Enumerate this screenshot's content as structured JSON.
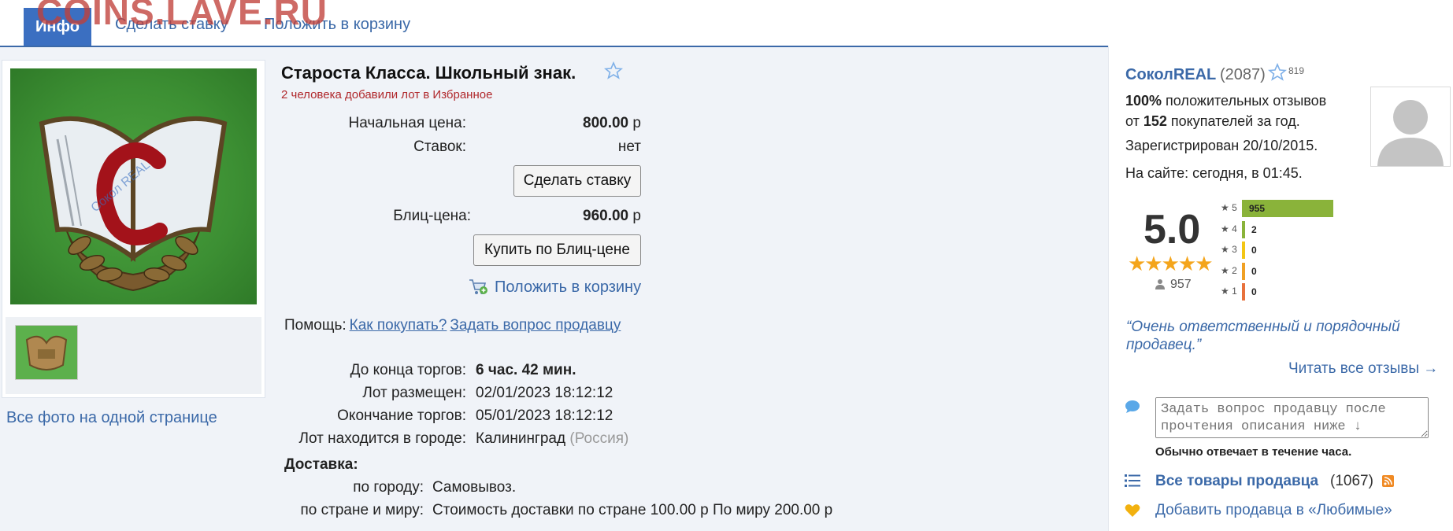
{
  "watermark": "COINS.LAVE.RU",
  "tabs": {
    "info": "Инфо",
    "bid": "Сделать ставку",
    "cart": "Положить в корзину"
  },
  "gallery": {
    "all_photos": "Все фото на одной странице",
    "photo_caption": "Сокол REAL",
    "photo_letter": "С"
  },
  "lot": {
    "title": "Староста Класса. Школьный знак.",
    "favorites_note": "2 человека добавили лот в Избранное",
    "start_price_label": "Начальная цена:",
    "start_price_value": "800.00",
    "currency": "р",
    "bids_label": "Ставок:",
    "bids_value": "нет",
    "bid_button": "Сделать ставку",
    "blitz_label": "Блиц-цена:",
    "blitz_value": "960.00",
    "blitz_button": "Купить по Блиц-цене",
    "cart_link": "Положить в корзину",
    "help_label": "Помощь:",
    "help_how": "Как покупать?",
    "help_ask": "Задать вопрос продавцу",
    "time_left_label": "До конца торгов:",
    "time_left_value": "6 час. 42 мин.",
    "placed_label": "Лот размещен:",
    "placed_value": "02/01/2023 18:12:12",
    "ends_label": "Окончание торгов:",
    "ends_value": "05/01/2023 18:12:12",
    "city_label": "Лот находится в городе:",
    "city_value": "Калининград",
    "country_value": "(Россия)",
    "delivery_heading": "Доставка:",
    "by_city_label": "по городу:",
    "by_city_value": "Самовывоз.",
    "by_country_label": "по стране и миру:",
    "by_country_value": "Стоимость доставки по стране 100.00 р По миру 200.00 р"
  },
  "seller": {
    "name": "СоколREAL",
    "feedback_count": "(2087)",
    "fav_count": "819",
    "positive_pct": "100%",
    "positive_text": " положительных отзывов",
    "from_text": "от ",
    "buyers_count": "152",
    "buyers_text": " покупателей за год.",
    "registered": "Зарегистрирован 20/10/2015.",
    "online": "На сайте: сегодня, в 01:45.",
    "rating": "5.0",
    "stars": "★★★★★",
    "voters": "957",
    "rating_bars": [
      {
        "label": "★ 5",
        "count": 955,
        "color": "#8ab33a"
      },
      {
        "label": "★ 4",
        "count": 2,
        "color": "#8ab33a"
      },
      {
        "label": "★ 3",
        "count": 0,
        "color": "#f3c614"
      },
      {
        "label": "★ 2",
        "count": 0,
        "color": "#f0a024"
      },
      {
        "label": "★ 1",
        "count": 0,
        "color": "#e8713c"
      }
    ],
    "quote": "“Очень ответственный и порядочный продавец.”",
    "all_reviews": "Читать все отзывы →",
    "ask_placeholder": "Задать вопрос продавцу после прочтения описания ниже ↓",
    "reply_note": "Обычно отвечает в течение часа.",
    "all_goods": "Все товары продавца",
    "goods_count": "(1067)",
    "add_favorite": "Добавить продавца в «Любимые»"
  },
  "colors": {
    "link": "#3b69a8",
    "tab_active": "#3b6fc1",
    "fav_note": "#b0282c",
    "star_gold": "#f4a51c"
  }
}
